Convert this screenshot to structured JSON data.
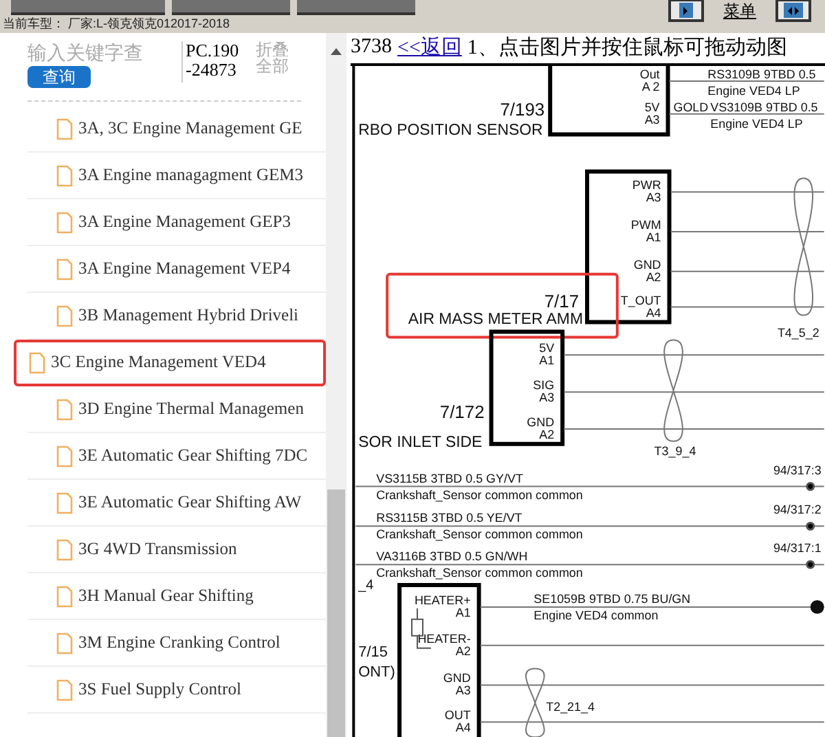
{
  "top_bar": {
    "menu_link": "菜单",
    "current_model": "当前车型：  厂家:L-领克领克012017-2018"
  },
  "sidebar": {
    "search": {
      "placeholder": "输入关键字查"
    },
    "search_button": "查询",
    "code": "PC.190-24873",
    "collapse_all": "折叠全部",
    "items": [
      {
        "label": "3A, 3C Engine Management GE",
        "selected": false
      },
      {
        "label": "3A Engine managagment GEM3",
        "selected": false
      },
      {
        "label": "3A Engine Management GEP3",
        "selected": false
      },
      {
        "label": "3A Engine Management VEP4",
        "selected": false
      },
      {
        "label": "3B Management Hybrid Driveli",
        "selected": false
      },
      {
        "label": "3C Engine Management VED4",
        "selected": true
      },
      {
        "label": "3D Engine Thermal Managemen",
        "selected": false
      },
      {
        "label": "3E Automatic Gear Shifting 7DC",
        "selected": false
      },
      {
        "label": "3E Automatic Gear Shifting AW",
        "selected": false
      },
      {
        "label": "3G 4WD Transmission",
        "selected": false
      },
      {
        "label": "3H Manual Gear Shifting",
        "selected": false
      },
      {
        "label": "3M Engine Cranking Control",
        "selected": false
      },
      {
        "label": "3S Fuel Supply Control",
        "selected": false
      }
    ]
  },
  "viewer": {
    "page_number": "3738",
    "back_link": "<<返回",
    "hint": "1、点击图片并按住鼠标可拖动动图",
    "diagram": {
      "components": [
        {
          "ref": "7/193",
          "name": "RBO POSITION SENSOR",
          "highlighted": false,
          "pins": [
            {
              "signal": "Out",
              "pin": "A 2"
            },
            {
              "signal": "5V",
              "pin": "A3"
            }
          ]
        },
        {
          "ref": "7/17",
          "name": "AIR MASS METER AMM",
          "highlighted": true,
          "pins": [
            {
              "signal": "PWR",
              "pin": "A3"
            },
            {
              "signal": "PWM",
              "pin": "A1"
            },
            {
              "signal": "GND",
              "pin": "A2"
            },
            {
              "signal": "T_OUT",
              "pin": "A4"
            }
          ]
        },
        {
          "ref": "7/172",
          "name": "SOR INLET SIDE",
          "highlighted": false,
          "pins": [
            {
              "signal": "5V",
              "pin": "A1"
            },
            {
              "signal": "SIG",
              "pin": "A3"
            },
            {
              "signal": "GND",
              "pin": "A2"
            }
          ]
        },
        {
          "ref": "7/15",
          "name": "ONT)",
          "highlighted": false,
          "pins": [
            {
              "signal": "HEATER+",
              "pin": "A1"
            },
            {
              "signal": "HEATER-",
              "pin": "A2"
            },
            {
              "signal": "GND",
              "pin": "A3"
            },
            {
              "signal": "OUT",
              "pin": "A4"
            }
          ]
        }
      ],
      "wires": [
        {
          "code": "RS3109B  9TBD 0.5",
          "circuit": "Engine  VED4  LP"
        },
        {
          "tag": "GOLD",
          "code": "VS3109B  9TBD 0.5",
          "circuit": "Engine  VED4  LP"
        },
        {
          "code": "VS3115B  3TBD 0.5 GY/VT",
          "circuit": "Crankshaft_Sensor  common   common",
          "splice": "94/317:3"
        },
        {
          "code": "RS3115B  3TBD 0.5 YE/VT",
          "circuit": "Crankshaft_Sensor  common   common",
          "splice": "94/317:2"
        },
        {
          "code": "VA3116B  3TBD 0.5 GN/WH",
          "circuit": "Crankshaft_Sensor  common   common",
          "splice": "94/317:1"
        },
        {
          "code": "SE1059B  9TBD 0.75 BU/GN",
          "circuit": "Engine  VED4   common"
        }
      ],
      "twists": [
        "T4_5_2",
        "T3_9_4",
        "T2_21_4"
      ],
      "edge_label": "_4"
    }
  }
}
